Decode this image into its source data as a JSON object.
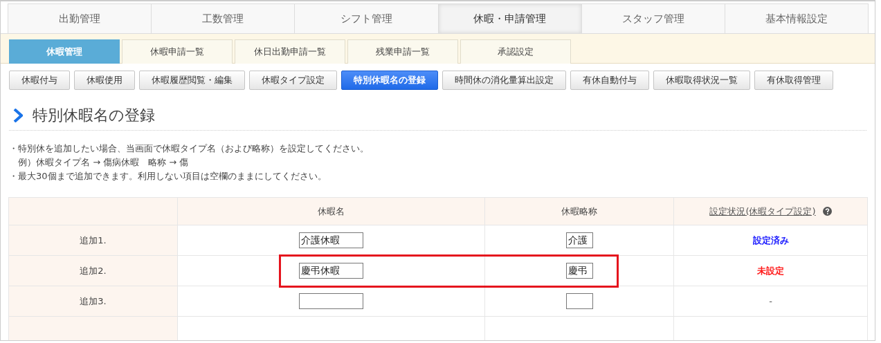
{
  "main_tabs": [
    {
      "label": "出勤管理",
      "selected": false
    },
    {
      "label": "工数管理",
      "selected": false
    },
    {
      "label": "シフト管理",
      "selected": false
    },
    {
      "label": "休暇・申請管理",
      "selected": true
    },
    {
      "label": "スタッフ管理",
      "selected": false
    },
    {
      "label": "基本情報設定",
      "selected": false
    }
  ],
  "sub_tabs": [
    {
      "label": "休暇管理",
      "selected": true
    },
    {
      "label": "休暇申請一覧",
      "selected": false
    },
    {
      "label": "休日出勤申請一覧",
      "selected": false
    },
    {
      "label": "残業申請一覧",
      "selected": false
    },
    {
      "label": "承認設定",
      "selected": false
    }
  ],
  "action_buttons": [
    {
      "label": "休暇付与",
      "selected": false
    },
    {
      "label": "休暇使用",
      "selected": false
    },
    {
      "label": "休暇履歴閲覧・編集",
      "selected": false
    },
    {
      "label": "休暇タイプ設定",
      "selected": false
    },
    {
      "label": "特別休暇名の登録",
      "selected": true
    },
    {
      "label": "時間休の消化量算出設定",
      "selected": false
    },
    {
      "label": "有休自動付与",
      "selected": false
    },
    {
      "label": "休暇取得状況一覧",
      "selected": false
    },
    {
      "label": "有休取得管理",
      "selected": false
    }
  ],
  "heading": "特別休暇名の登録",
  "notes": [
    {
      "kind": "bullet",
      "text": "・特別休を追加したい場合、当画面で休暇タイプ名（および略称）を設定してください。"
    },
    {
      "kind": "indent",
      "text": "例）休暇タイプ名 → 傷病休暇　略称 → 傷"
    },
    {
      "kind": "bullet",
      "text": "・最大30個まで追加できます。利用しない項目は空欄のままにしてください。"
    }
  ],
  "table": {
    "columns": [
      {
        "label": "休暇名",
        "kind": "text"
      },
      {
        "label": "休暇略称",
        "kind": "text"
      },
      {
        "label": "設定状況(休暇タイプ設定)",
        "kind": "link"
      }
    ],
    "rows": [
      {
        "label": "追加1.",
        "name": "介護休暇",
        "abbreviation": "介護",
        "status": "設定済み",
        "color": "#1a1aff",
        "highlighted": false
      },
      {
        "label": "追加2.",
        "name": "慶弔休暇",
        "abbreviation": "慶弔",
        "status": "未設定",
        "color": "#ff1a1a",
        "highlighted": true
      },
      {
        "label": "追加3.",
        "name": "",
        "abbreviation": "",
        "status": "-",
        "color": "#555555",
        "highlighted": false
      }
    ]
  }
}
